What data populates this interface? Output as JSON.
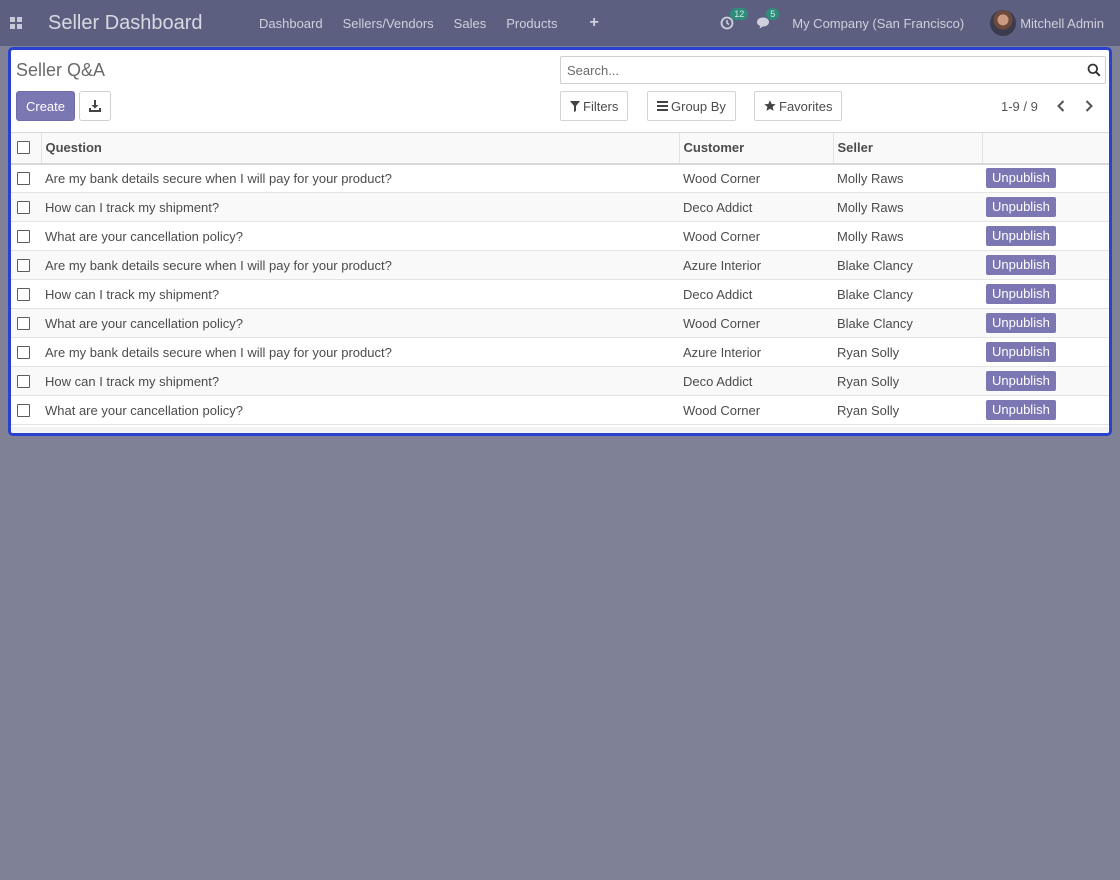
{
  "navbar": {
    "brand": "Seller Dashboard",
    "menu": [
      "Dashboard",
      "Sellers/Vendors",
      "Sales",
      "Products"
    ],
    "plus_symbol": "+",
    "activity_count": "12",
    "messages_count": "5",
    "company": "My Company (San Francisco)",
    "user": "Mitchell Admin"
  },
  "control_panel": {
    "title": "Seller Q&A",
    "create_label": "Create",
    "search_placeholder": "Search...",
    "filters_label": "Filters",
    "groupby_label": "Group By",
    "favorites_label": "Favorites",
    "pager_text": "1-9 / 9"
  },
  "table": {
    "headers": [
      "Question",
      "Customer",
      "Seller"
    ],
    "action_label": "Unpublish",
    "rows": [
      {
        "question": "Are my bank details secure when I will pay for your product?",
        "customer": "Wood Corner",
        "seller": "Molly Raws"
      },
      {
        "question": "How can I track my shipment?",
        "customer": "Deco Addict",
        "seller": "Molly Raws"
      },
      {
        "question": "What are your cancellation policy?",
        "customer": "Wood Corner",
        "seller": "Molly Raws"
      },
      {
        "question": "Are my bank details secure when I will pay for your product?",
        "customer": "Azure Interior",
        "seller": "Blake Clancy"
      },
      {
        "question": "How can I track my shipment?",
        "customer": "Deco Addict",
        "seller": "Blake Clancy"
      },
      {
        "question": "What are your cancellation policy?",
        "customer": "Wood Corner",
        "seller": "Blake Clancy"
      },
      {
        "question": "Are my bank details secure when I will pay for your product?",
        "customer": "Azure Interior",
        "seller": "Ryan Solly"
      },
      {
        "question": "How can I track my shipment?",
        "customer": "Deco Addict",
        "seller": "Ryan Solly"
      },
      {
        "question": "What are your cancellation policy?",
        "customer": "Wood Corner",
        "seller": "Ryan Solly"
      }
    ]
  },
  "colors": {
    "navbar_bg": "#5c5f80",
    "primary_button": "#7a77b2",
    "panel_border": "#2a41d0",
    "backdrop": "#7f8296",
    "badge": "#2f8d7b"
  },
  "icons": [
    "apps-icon",
    "activity-clock-icon",
    "messages-icon",
    "download-icon",
    "search-icon",
    "filter-icon",
    "group-by-bars-icon",
    "favorites-star-icon",
    "chevron-left-icon",
    "chevron-right-icon"
  ]
}
